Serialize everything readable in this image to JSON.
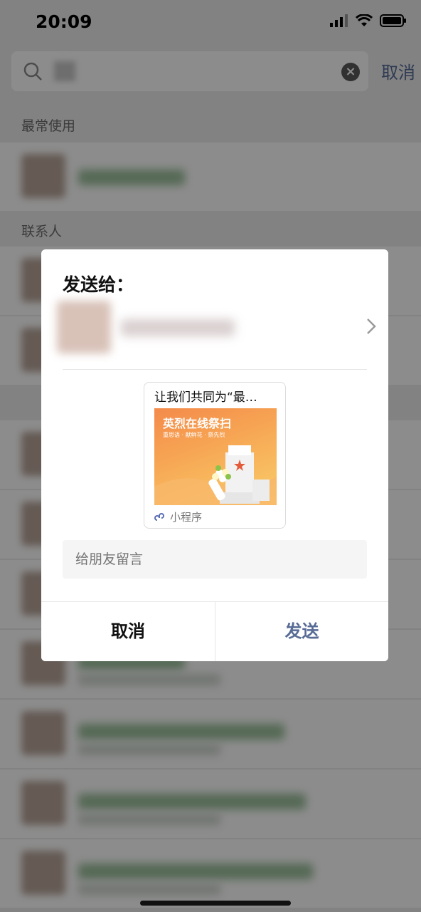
{
  "status_bar": {
    "time": "20:09"
  },
  "search": {
    "cancel_label": "取消"
  },
  "sections": {
    "frequent_title": "最常使用",
    "contacts_title": "联系人"
  },
  "dialog": {
    "title": "发送给：",
    "card": {
      "title": "让我们共同为“最…",
      "image_banner": "英烈在线祭扫",
      "image_subtitle": "重思语 · 献鲜花 · 祭先烈",
      "tag": "小程序"
    },
    "message_placeholder": "给朋友留言",
    "cancel_label": "取消",
    "send_label": "发送"
  },
  "colors": {
    "accent": "#576b95",
    "background": "#ededed"
  }
}
